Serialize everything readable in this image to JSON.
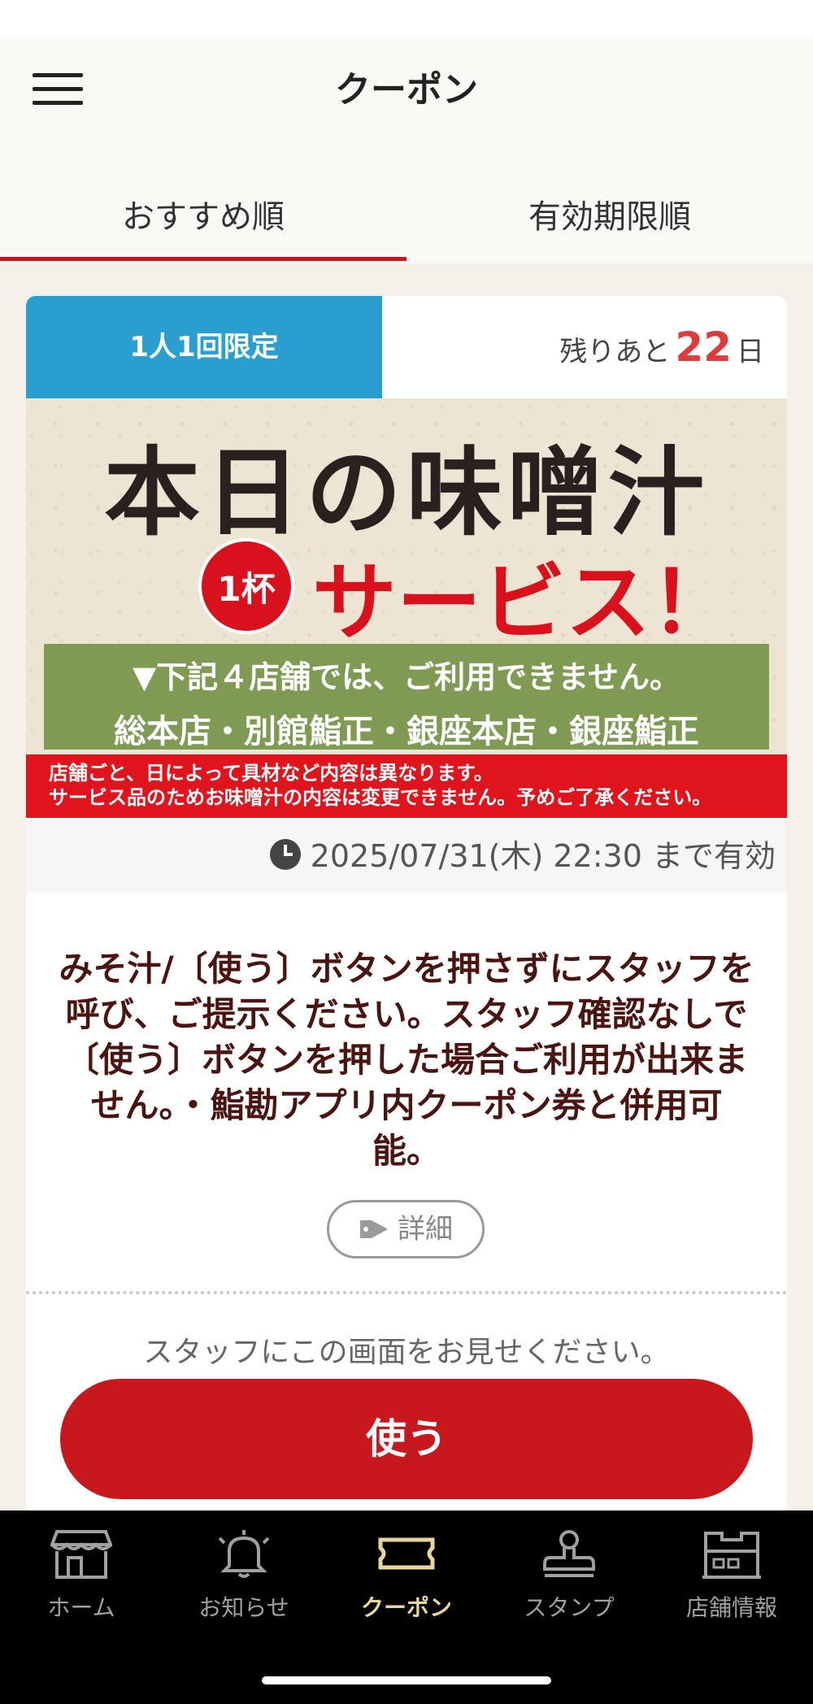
{
  "header": {
    "title": "クーポン",
    "menu_icon": "hamburger-icon"
  },
  "tabs": [
    {
      "label": "おすすめ順",
      "active": true
    },
    {
      "label": "有効期限順",
      "active": false
    }
  ],
  "coupon": {
    "limit_badge": "1人1回限定",
    "remaining_prefix": "残りあと",
    "remaining_days": "22",
    "remaining_suffix": "日",
    "banner": {
      "title": "本日の味噌汁",
      "cup_label": "1杯",
      "service_text": "サービス！",
      "green_line1": "▼下記４店舗では、ご利用できません。",
      "green_line2": "総本店・別館鮨正・銀座本店・銀座鮨正",
      "red_line1": "店舗ごと、日によって具材など内容は異なります。",
      "red_line2": "サービス品のためお味噌汁の内容は変更できません。予めご了承ください。"
    },
    "expiry_text": "2025/07/31(木) 22:30 まで有効",
    "description": "みそ汁/〔使う〕ボタンを押さずにスタッフを呼び、ご提示ください。スタッフ確認なしで〔使う〕ボタンを押した場合ご利用が出来ません。・鮨勘アプリ内クーポン券と併用可能。",
    "detail_label": "詳細",
    "show_staff": "スタッフにこの画面をお見せください。",
    "use_label": "使う"
  },
  "bottom_nav": [
    {
      "label": "ホーム",
      "icon": "store-icon",
      "active": false
    },
    {
      "label": "お知らせ",
      "icon": "bell-icon",
      "active": false
    },
    {
      "label": "クーポン",
      "icon": "ticket-icon",
      "active": true
    },
    {
      "label": "スタンプ",
      "icon": "stamp-icon",
      "active": false
    },
    {
      "label": "店舗情報",
      "icon": "building-icon",
      "active": false
    }
  ],
  "colors": {
    "accent_red": "#c8171d",
    "badge_blue": "#2a9fcf",
    "nav_active": "#e7d59b"
  }
}
